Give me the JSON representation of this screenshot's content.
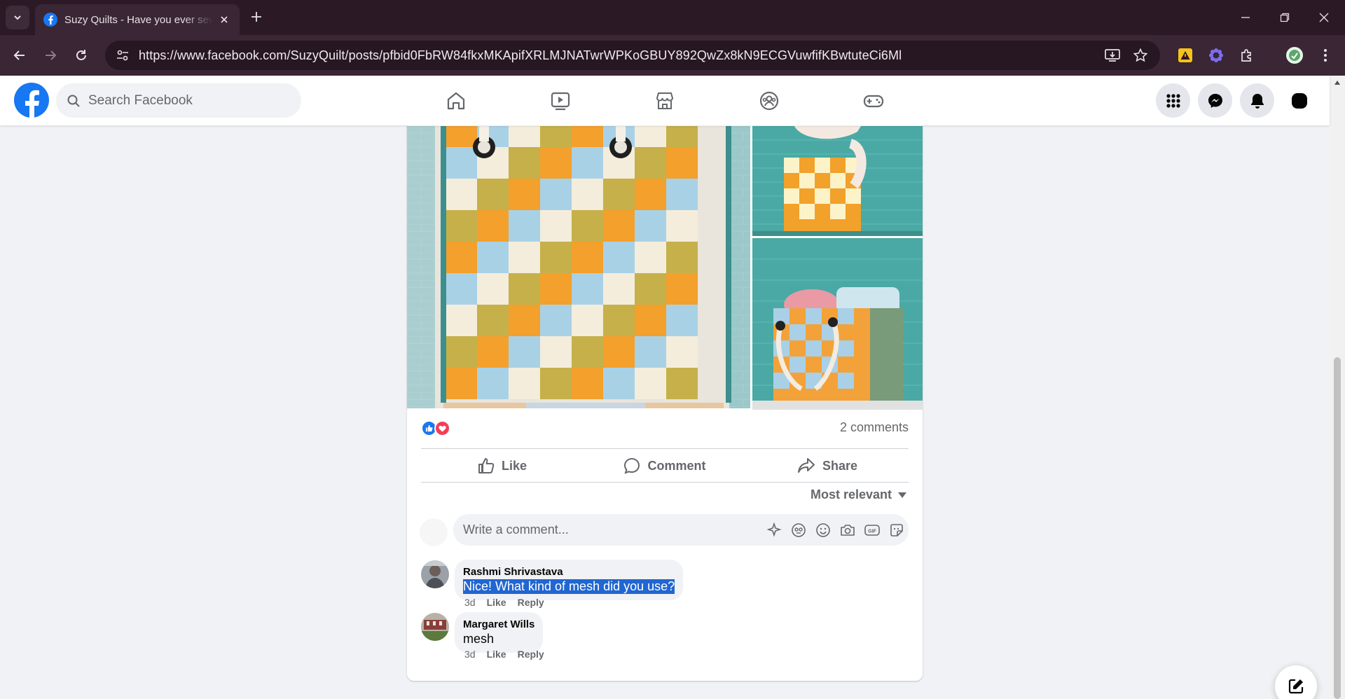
{
  "browser": {
    "tab_title": "Suzy Quilts - Have you ever sewn",
    "url": "https://www.facebook.com/SuzyQuilt/posts/pfbid0FbRW84fkxMKApifXRLMJNATwrWPKoGBUY892QwZx8kN9ECGVuwfifKBwtuteCi6Ml"
  },
  "facebook": {
    "search_placeholder": "Search Facebook",
    "brand_color": "#1877f2"
  },
  "post": {
    "comments_count": "2 comments",
    "actions": {
      "like": "Like",
      "comment": "Comment",
      "share": "Share"
    },
    "sort_label": "Most relevant",
    "composer_placeholder": "Write a comment...",
    "comments": [
      {
        "author": "Rashmi Shrivastava",
        "text": "Nice! What kind of mesh did you use?",
        "time": "3d",
        "like": "Like",
        "reply": "Reply"
      },
      {
        "author": "Margaret Wills",
        "text": "mesh",
        "time": "3d",
        "like": "Like",
        "reply": "Reply"
      }
    ]
  }
}
